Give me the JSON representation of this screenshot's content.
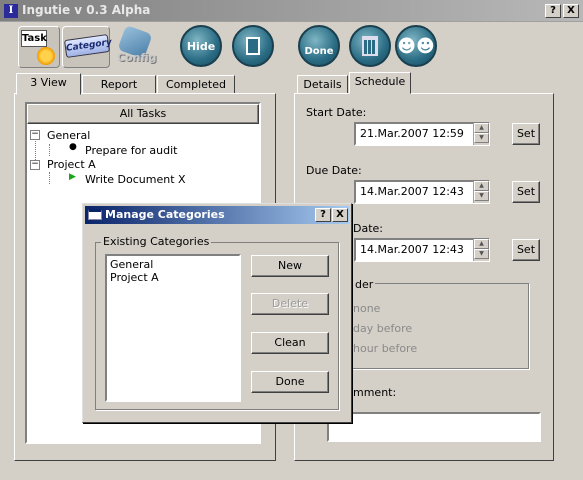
{
  "window": {
    "title": "Ingutie v 0.3 Alpha",
    "icon_letter": "I",
    "help_btn": "?",
    "close_btn": "X"
  },
  "toolbar": {
    "task_label": "Task",
    "category_label": "Category",
    "config_label": "Config",
    "hide_label": "Hide",
    "done_label": "Done"
  },
  "left_tabs": [
    "3 View",
    "Report",
    "Completed"
  ],
  "tree": {
    "header": "All Tasks",
    "nodes": [
      {
        "label": "General",
        "expander": "−"
      },
      {
        "label": "Prepare for audit",
        "bullet": "●"
      },
      {
        "label": "Project A",
        "expander": "−"
      },
      {
        "label": "Write Document X",
        "bullet": "▶"
      }
    ]
  },
  "right_tabs": [
    "Details",
    "Schedule"
  ],
  "schedule": {
    "start_label": "Start Date:",
    "start_value": "21.Mar.2007 12:59",
    "due_label": "Due Date:",
    "due_value": "14.Mar.2007 12:43",
    "third_label": "Date:",
    "third_value": "14.Mar.2007 12:43",
    "set_label": "Set",
    "reminder_label": "der",
    "reminder_options": [
      "none",
      "day before",
      "hour before"
    ],
    "comment_label": "mment:"
  },
  "dialog": {
    "title": "Manage Categories",
    "help_btn": "?",
    "close_btn": "X",
    "group_label": "Existing Categories",
    "categories": [
      "General",
      "Project A"
    ],
    "new_label": "New",
    "delete_label": "Delete",
    "clean_label": "Clean",
    "done_label": "Done"
  }
}
